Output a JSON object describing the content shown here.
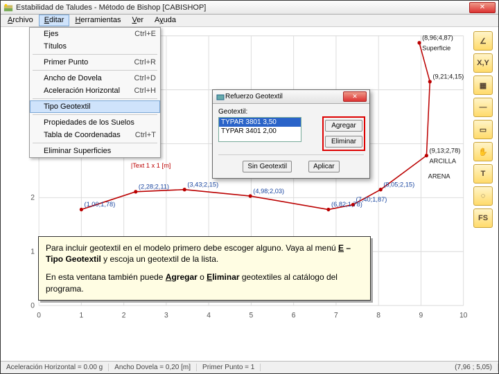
{
  "window": {
    "title": "Estabilidad de Taludes - Método de Bishop [CABISHOP]",
    "close": "✕"
  },
  "menubar": [
    {
      "label": "Archivo",
      "u": "A"
    },
    {
      "label": "Editar",
      "u": "E",
      "active": true
    },
    {
      "label": "Herramientas",
      "u": "H"
    },
    {
      "label": "Ver",
      "u": "V"
    },
    {
      "label": "Ayuda",
      "u": "y"
    }
  ],
  "dropdown": [
    {
      "label": "Ejes",
      "shortcut": "Ctrl+E"
    },
    {
      "label": "Títulos",
      "shortcut": ""
    },
    {
      "sep": true
    },
    {
      "label": "Primer Punto",
      "shortcut": "Ctrl+R"
    },
    {
      "sep": true
    },
    {
      "label": "Ancho de Dovela",
      "shortcut": "Ctrl+D"
    },
    {
      "label": "Aceleración Horizontal",
      "shortcut": "Ctrl+H"
    },
    {
      "sep": true
    },
    {
      "label": "Tipo Geotextil",
      "shortcut": "",
      "sel": true
    },
    {
      "sep": true
    },
    {
      "label": "Propiedades de los Suelos",
      "shortcut": ""
    },
    {
      "label": "Tabla de Coordenadas",
      "shortcut": "Ctrl+T"
    },
    {
      "sep": true
    },
    {
      "label": "Eliminar Superficies",
      "shortcut": ""
    }
  ],
  "tools": [
    {
      "name": "angle-icon",
      "glyph": "∠"
    },
    {
      "name": "coords-icon",
      "glyph": "X,Y"
    },
    {
      "name": "wall-icon",
      "glyph": "▦"
    },
    {
      "name": "dash-icon",
      "glyph": "—"
    },
    {
      "name": "rect-icon",
      "glyph": "▭"
    },
    {
      "name": "hand-icon",
      "glyph": "✋"
    },
    {
      "name": "text-icon",
      "glyph": "T"
    },
    {
      "name": "circles-icon",
      "glyph": "◌"
    },
    {
      "name": "fs-icon",
      "glyph": "FS"
    }
  ],
  "dialog": {
    "title": "Refuerzo Geotextil",
    "close": "✕",
    "listLabel": "Geotextil:",
    "items": [
      {
        "text": "TYPAR 3801 3,50",
        "sel": true
      },
      {
        "text": "TYPAR 3401 2,00",
        "sel": false
      }
    ],
    "add": "Agregar",
    "del": "Eliminar",
    "noGeo": "Sin Geotextil",
    "apply": "Aplicar"
  },
  "tip": {
    "p1a": "Para incluir geotextil en el modelo primero debe escoger alguno. Vaya al menú ",
    "p1b": "Editar – Tipo Geotextil",
    "p1c": " y escoja un geotextil de la lista.",
    "p2a": "En esta ventana también puede ",
    "p2b": "Agregar",
    "p2c": " o ",
    "p2d": "Eliminar",
    "p2e": " geotextiles al catálogo del programa."
  },
  "status": {
    "accel": "Aceleración Horizontal = 0.00 g",
    "dovel": "Ancho Dovela = 0,20 [m]",
    "primer": "Primer Punto = 1",
    "coord": "(7,96 ; 5,05)"
  },
  "chart_data": {
    "type": "line",
    "xlim": [
      0,
      10
    ],
    "ylim": [
      0,
      5
    ],
    "xlabel": "",
    "ylabel": "",
    "series": [
      {
        "name": "Superficie",
        "color": "#b00",
        "points": [
          [
            1.0,
            1.78
          ],
          [
            2.28,
            2.11
          ],
          [
            3.43,
            2.15
          ],
          [
            4.98,
            2.03
          ],
          [
            6.82,
            1.78
          ],
          [
            7.4,
            1.87
          ],
          [
            8.05,
            2.15
          ],
          [
            9.13,
            2.78
          ],
          [
            9.21,
            4.15
          ],
          [
            8.96,
            4.87
          ]
        ]
      }
    ],
    "annotations": [
      {
        "text": "(1,00;1,78)",
        "xy": [
          1.0,
          1.78
        ]
      },
      {
        "text": "(2,28;2,11)",
        "xy": [
          2.28,
          2.11
        ]
      },
      {
        "text": "(3,43;2,15)",
        "xy": [
          3.43,
          2.15
        ]
      },
      {
        "text": "(4,98;2,03)",
        "xy": [
          4.98,
          2.03
        ]
      },
      {
        "text": "(6,82;1,78)",
        "xy": [
          6.82,
          1.78
        ]
      },
      {
        "text": "(7,40;1,87)",
        "xy": [
          7.4,
          1.87
        ]
      },
      {
        "text": "(8,05;2,15)",
        "xy": [
          8.05,
          2.15
        ]
      },
      {
        "text": "(9,13;2,78)",
        "xy": [
          9.13,
          2.78
        ],
        "note": "ARCILLA"
      },
      {
        "text": "(9,21;4,15)",
        "xy": [
          9.21,
          4.15
        ]
      },
      {
        "text": "(8,96;4,87)",
        "xy": [
          8.96,
          4.87
        ],
        "note": "Superficie"
      },
      {
        "text": "ARENA",
        "xy": [
          9.1,
          2.3
        ]
      },
      {
        "text": "|Text 1 x 1 [m]",
        "xy": [
          2.1,
          2.5
        ],
        "color": "red"
      }
    ]
  }
}
